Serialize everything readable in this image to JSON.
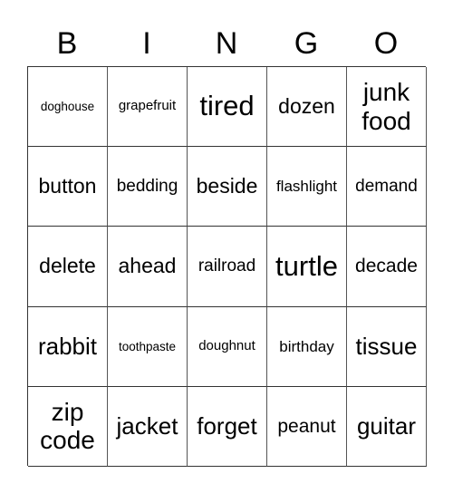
{
  "header": {
    "letters": [
      "B",
      "I",
      "N",
      "G",
      "O"
    ]
  },
  "board": {
    "rows": [
      [
        {
          "text": "doghouse",
          "size": "s13"
        },
        {
          "text": "grapefruit",
          "size": "s15"
        },
        {
          "text": "tired",
          "size": "s30"
        },
        {
          "text": "dozen",
          "size": "s23"
        },
        {
          "text": "junk\nfood",
          "size": "s28"
        }
      ],
      [
        {
          "text": "button",
          "size": "s23"
        },
        {
          "text": "bedding",
          "size": "s19"
        },
        {
          "text": "beside",
          "size": "s23"
        },
        {
          "text": "flashlight",
          "size": "s17"
        },
        {
          "text": "demand",
          "size": "s19"
        }
      ],
      [
        {
          "text": "delete",
          "size": "s23"
        },
        {
          "text": "ahead",
          "size": "s23"
        },
        {
          "text": "railroad",
          "size": "s19"
        },
        {
          "text": "turtle",
          "size": "s30"
        },
        {
          "text": "decade",
          "size": "s21"
        }
      ],
      [
        {
          "text": "rabbit",
          "size": "s26"
        },
        {
          "text": "toothpaste",
          "size": "s13"
        },
        {
          "text": "doughnut",
          "size": "s15"
        },
        {
          "text": "birthday",
          "size": "s17"
        },
        {
          "text": "tissue",
          "size": "s26"
        }
      ],
      [
        {
          "text": "zip\ncode",
          "size": "s28"
        },
        {
          "text": "jacket",
          "size": "s26"
        },
        {
          "text": "forget",
          "size": "s26"
        },
        {
          "text": "peanut",
          "size": "s21"
        },
        {
          "text": "guitar",
          "size": "s26"
        }
      ]
    ]
  }
}
